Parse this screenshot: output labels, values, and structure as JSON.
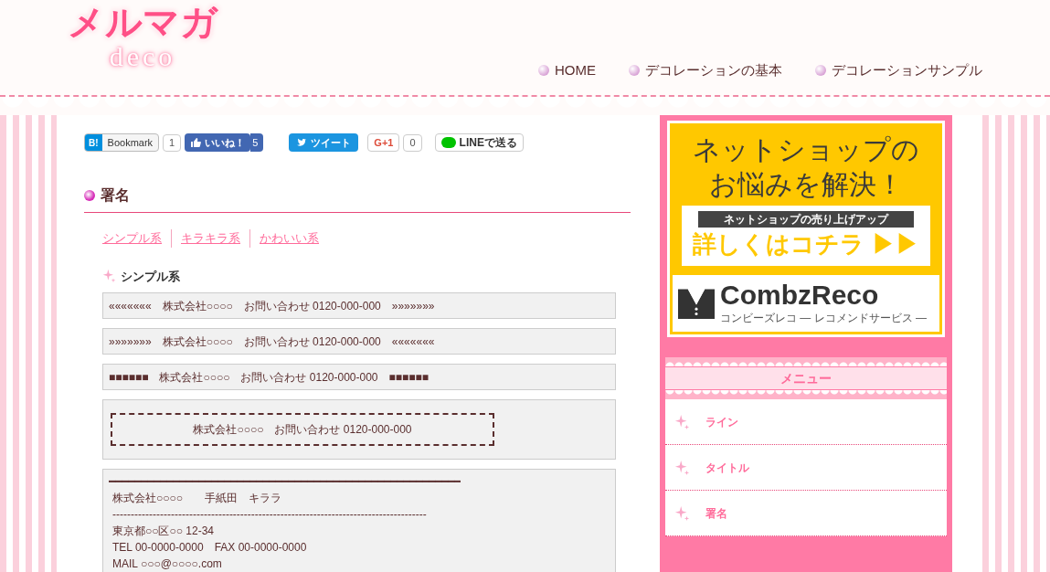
{
  "logo": {
    "title": "メルマガ",
    "subtitle": "deco"
  },
  "nav": [
    {
      "label": "HOME"
    },
    {
      "label": "デコレーションの基本"
    },
    {
      "label": "デコレーションサンプル"
    }
  ],
  "share": [
    {
      "kind": "hatena",
      "badge": "B!",
      "label": "Bookmark",
      "count": "1"
    },
    {
      "kind": "facebook",
      "label": "いいね！",
      "count": "5"
    },
    {
      "kind": "twitter",
      "label": "ツイート"
    },
    {
      "kind": "gplus",
      "label": "G+1",
      "count": "0"
    },
    {
      "kind": "line",
      "label": "LINEで送る"
    }
  ],
  "heading": "署名",
  "links": [
    "シンプル系",
    "キラキラ系",
    "かわいい系"
  ],
  "section": "シンプル系",
  "signatures": [
    {
      "kind": "line",
      "lines": [
        "«««««««　株式会社○○○○　お問い合わせ 0120-000-000　»»»»»»»"
      ]
    },
    {
      "kind": "line",
      "lines": [
        "»»»»»»»　株式会社○○○○　お問い合わせ 0120-000-000　«««««««"
      ]
    },
    {
      "kind": "line",
      "lines": [
        "■■■■■■　株式会社○○○○　お問い合わせ 0120-000-000　■■■■■■"
      ]
    },
    {
      "kind": "framed",
      "lines": [
        "株式会社○○○○　お問い合わせ 0120-000-000"
      ]
    },
    {
      "kind": "area",
      "lines": [
        "━━━━━━━━━━━━━━━━━━━━━━━━━━━━━━━━━━━━━━━━━━━━━━━━━━━━━━━",
        "株式会社○○○○　　手紙田　キララ",
        "--------------------------------------------------------------------------------------",
        "東京都○○区○○ 12-34",
        "TEL 00-0000-0000　FAX 00-0000-0000",
        "MAIL ○○○@○○○○.com"
      ]
    }
  ],
  "ad": {
    "headline": [
      "ネットショップの",
      "お悩みを解決！"
    ],
    "tag": "ネットショップの売り上げアップ",
    "cta": "詳しくはコチラ ▶▶",
    "brand": "CombzReco",
    "brand_sub": "コンビーズレコ — レコメンドサービス —"
  },
  "menu": {
    "title": "メニュー",
    "items": [
      {
        "label": "ライン"
      },
      {
        "label": "タイトル"
      },
      {
        "label": "署名"
      }
    ]
  }
}
